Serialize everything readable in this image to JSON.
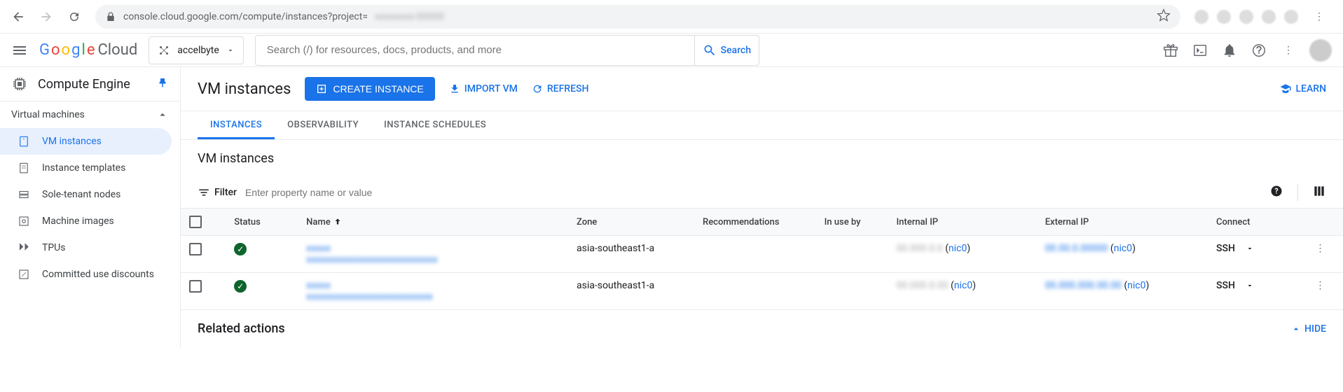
{
  "browser": {
    "url": "console.cloud.google.com/compute/instances?project="
  },
  "header": {
    "logo_cloud": "Cloud",
    "project": "accelbyte",
    "search_placeholder": "Search (/) for resources, docs, products, and more",
    "search_button": "Search"
  },
  "sidebar": {
    "product_title": "Compute Engine",
    "group": "Virtual machines",
    "items": [
      {
        "label": "VM instances",
        "active": true
      },
      {
        "label": "Instance templates"
      },
      {
        "label": "Sole-tenant nodes"
      },
      {
        "label": "Machine images"
      },
      {
        "label": "TPUs"
      },
      {
        "label": "Committed use discounts"
      }
    ]
  },
  "content": {
    "title": "VM instances",
    "create_btn": "CREATE INSTANCE",
    "import_btn": "IMPORT VM",
    "refresh_btn": "REFRESH",
    "learn_btn": "LEARN",
    "tabs": [
      "INSTANCES",
      "OBSERVABILITY",
      "INSTANCE SCHEDULES"
    ],
    "section_title": "VM instances",
    "filter_label": "Filter",
    "filter_placeholder": "Enter property name or value",
    "columns": [
      "Status",
      "Name",
      "Zone",
      "Recommendations",
      "In use by",
      "Internal IP",
      "External IP",
      "Connect"
    ],
    "rows": [
      {
        "zone": "asia-southeast1-a",
        "internal_nic": "nic0",
        "external_nic": "nic0",
        "connect": "SSH"
      },
      {
        "zone": "asia-southeast1-a",
        "internal_nic": "nic0",
        "external_nic": "nic0",
        "connect": "SSH"
      }
    ],
    "related_title": "Related actions",
    "hide_btn": "HIDE"
  }
}
